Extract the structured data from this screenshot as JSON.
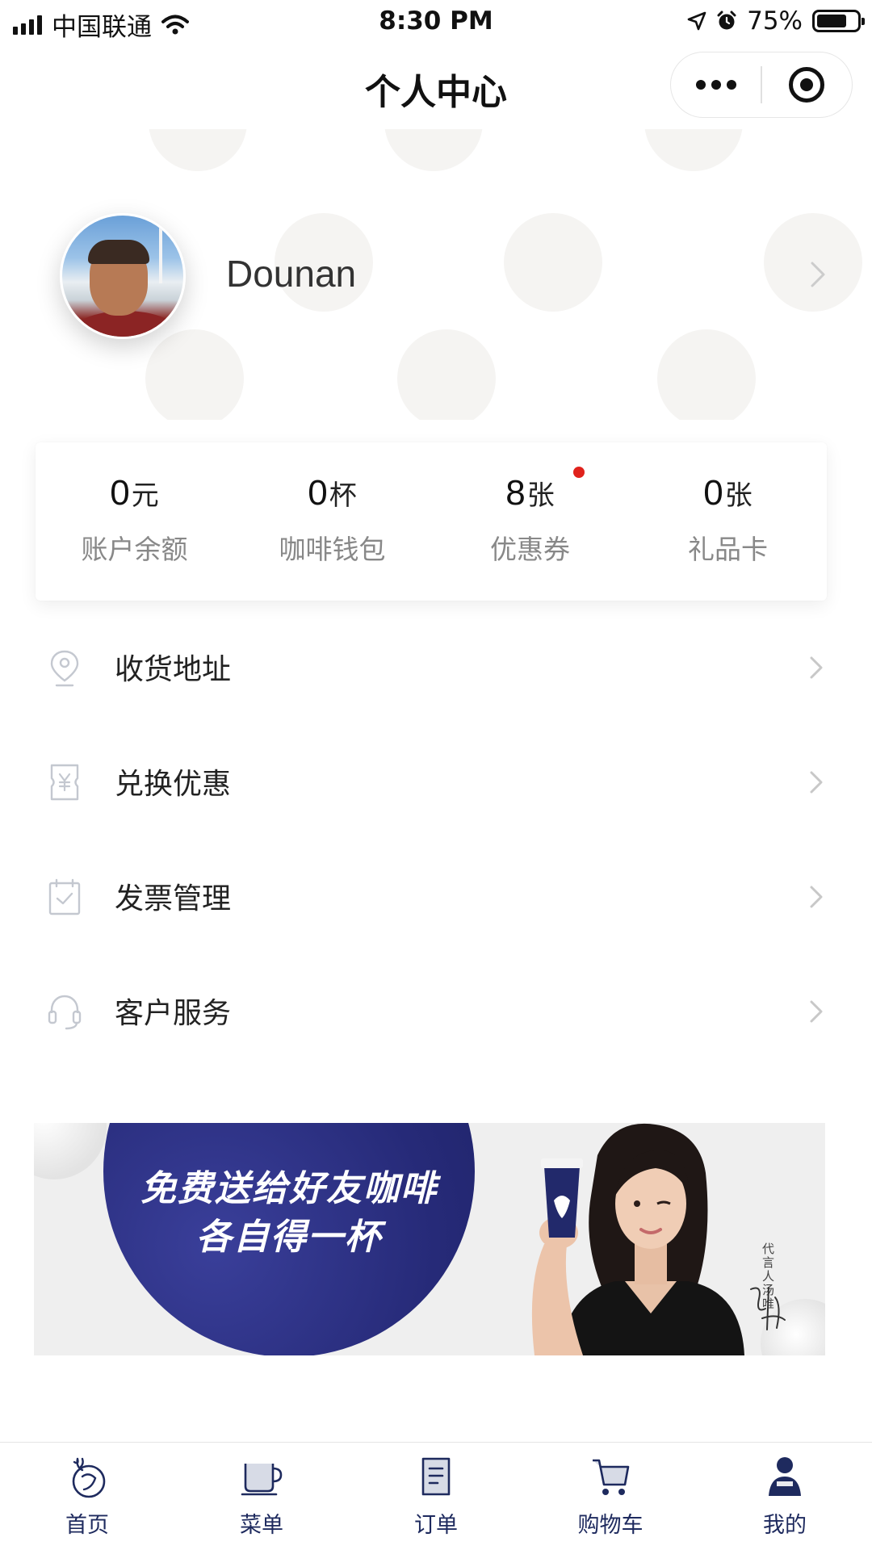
{
  "status_bar": {
    "carrier": "中国联通",
    "time": "8:30 PM",
    "battery_percent": "75%",
    "battery_level": 0.75
  },
  "nav": {
    "title": "个人中心"
  },
  "profile": {
    "username": "Dounan"
  },
  "stats": [
    {
      "num": "0",
      "unit": "元",
      "label": "账户余额",
      "has_dot": false
    },
    {
      "num": "0",
      "unit": "杯",
      "label": "咖啡钱包",
      "has_dot": false
    },
    {
      "num": "8",
      "unit": "张",
      "label": "优惠券",
      "has_dot": true
    },
    {
      "num": "0",
      "unit": "张",
      "label": "礼品卡",
      "has_dot": false
    }
  ],
  "menu": [
    {
      "label": "收货地址",
      "icon": "location-pin-icon"
    },
    {
      "label": "兑换优惠",
      "icon": "yen-voucher-icon"
    },
    {
      "label": "发票管理",
      "icon": "invoice-check-icon"
    },
    {
      "label": "客户服务",
      "icon": "headset-icon"
    }
  ],
  "banner": {
    "line1": "免费送给好友咖啡",
    "line2": "各自得一杯",
    "tag": "代言人 汤唯"
  },
  "tabbar": {
    "items": [
      {
        "label": "首页",
        "icon": "deer-logo-icon"
      },
      {
        "label": "菜单",
        "icon": "coffee-cup-icon"
      },
      {
        "label": "订单",
        "icon": "order-doc-icon"
      },
      {
        "label": "购物车",
        "icon": "cart-icon"
      },
      {
        "label": "我的",
        "icon": "user-icon"
      }
    ],
    "active_index": 4
  },
  "colors": {
    "brand_navy": "#1e2a5e",
    "badge_red": "#e0221c",
    "label_gray": "#888888"
  }
}
